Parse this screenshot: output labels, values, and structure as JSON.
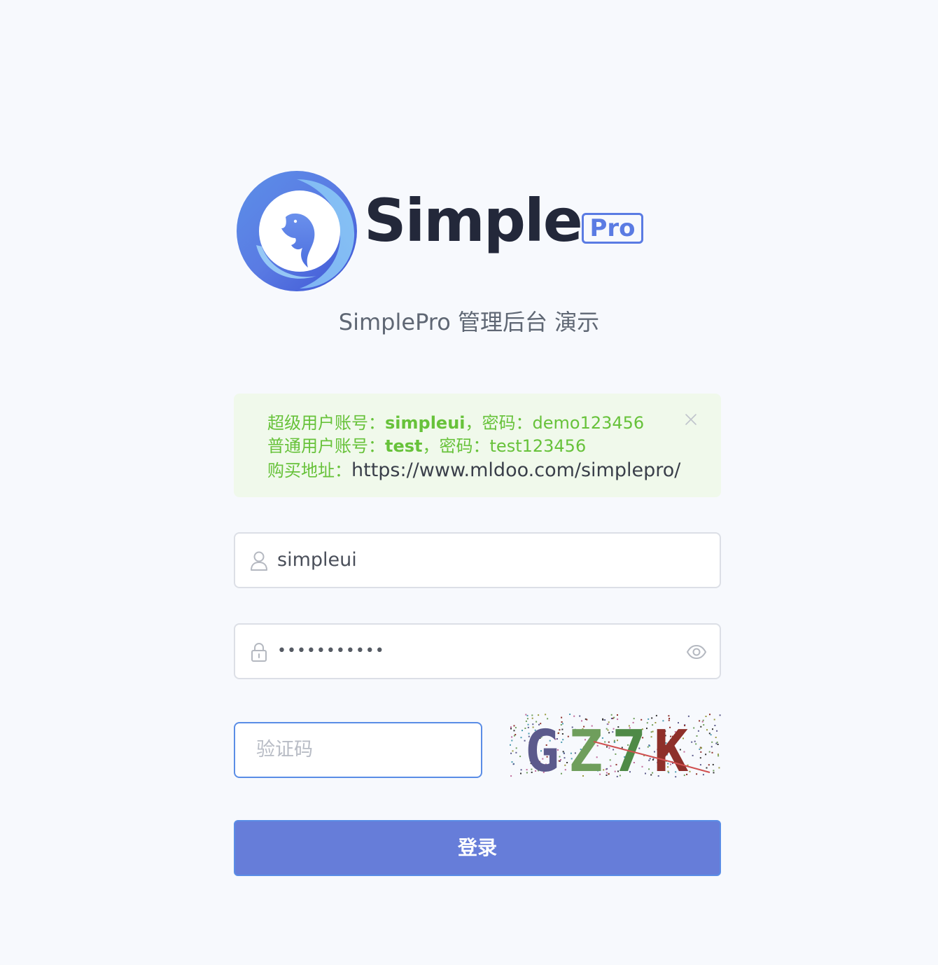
{
  "brand": {
    "wordmark": "Simple",
    "badge": "Pro",
    "subtitle": "SimplePro 管理后台 演示"
  },
  "alert": {
    "line1_label": "超级用户账号：",
    "line1_user": "simpleui",
    "line1_pwd_label": "，密码：",
    "line1_pwd": "demo123456",
    "line2_label": "普通用户账号：",
    "line2_user": "test",
    "line2_pwd_label": "，密码：",
    "line2_pwd": "test123456",
    "line3_label": "购买地址：",
    "line3_url": "https://www.mldoo.com/simplepro/"
  },
  "form": {
    "username_value": "simpleui",
    "password_masked": "•••••••••••",
    "captcha_placeholder": "验证码",
    "captcha_text": "GZ7K",
    "login_label": "登录"
  },
  "colors": {
    "accent": "#5a7be3",
    "button": "#667dd9",
    "success_text": "#67c23a",
    "success_bg": "#f0f9eb",
    "page_bg": "#f7f9fd"
  },
  "icons": {
    "user": "user-icon",
    "lock": "lock-icon",
    "eye": "eye-icon",
    "close": "close-icon"
  }
}
